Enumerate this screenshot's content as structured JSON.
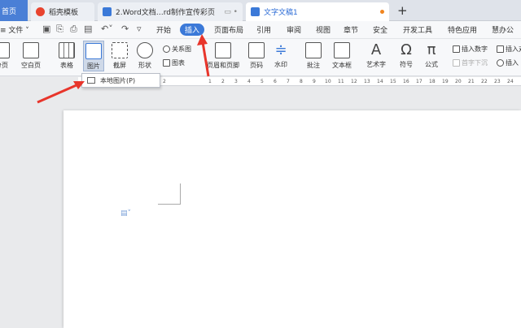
{
  "tabs": {
    "home": "首页",
    "daoke": "稻壳模板",
    "word2": "2.Word文档…rd制作宣传彩页",
    "active": "文字文稿1"
  },
  "menu": {
    "file": "文件",
    "tabs": [
      "开始",
      "插入",
      "页面布局",
      "引用",
      "审阅",
      "视图",
      "章节",
      "安全",
      "开发工具",
      "特色应用",
      "慧办公"
    ],
    "selected": "插入"
  },
  "ribbon": {
    "page": "分页",
    "blank_page": "空白页",
    "table": "表格",
    "picture": "图片",
    "screenshot": "截屏",
    "shape": "形状",
    "relation": "关系图",
    "chart": "图表",
    "header_footer": "页眉和页脚",
    "page_number": "页码",
    "watermark": "水印",
    "comment": "批注",
    "textbox": "文本框",
    "wordart": "艺术字",
    "symbol": "符号",
    "formula": "公式",
    "insert_number": "插入数字",
    "insert_object": "插入对象",
    "drop_cap": "首字下沉",
    "insert_link": "插入"
  },
  "dropdown": {
    "local_picture": "本地图片(P)"
  },
  "ruler_ticks": [
    "1",
    "2",
    "1",
    "2",
    "3",
    "4",
    "5",
    "6",
    "7",
    "8",
    "9",
    "10",
    "11",
    "12",
    "13",
    "14",
    "15",
    "16",
    "17",
    "18",
    "19",
    "20",
    "21",
    "22",
    "23",
    "24",
    "25"
  ],
  "colors": {
    "accent": "#3b79d8",
    "arrow": "#e8352b"
  }
}
